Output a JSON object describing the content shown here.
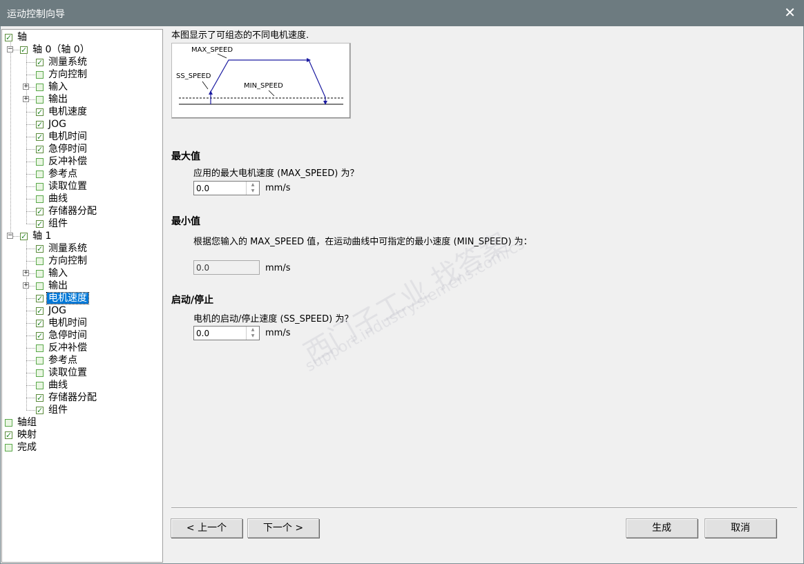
{
  "window": {
    "title": "运动控制向导",
    "close_glyph": "✕"
  },
  "tree": {
    "items": [
      {
        "label": "轴",
        "checked": true
      },
      {
        "label": "轴 0（轴 0）",
        "checked": true
      },
      {
        "label": "测量系统",
        "checked": true
      },
      {
        "label": "方向控制",
        "checked": false
      },
      {
        "label": "输入",
        "checked": false
      },
      {
        "label": "输出",
        "checked": false
      },
      {
        "label": "电机速度",
        "checked": true
      },
      {
        "label": "JOG",
        "checked": true
      },
      {
        "label": "电机时间",
        "checked": true
      },
      {
        "label": "急停时间",
        "checked": true
      },
      {
        "label": "反冲补偿",
        "checked": false
      },
      {
        "label": "参考点",
        "checked": false
      },
      {
        "label": "读取位置",
        "checked": false
      },
      {
        "label": "曲线",
        "checked": false
      },
      {
        "label": "存储器分配",
        "checked": true
      },
      {
        "label": "组件",
        "checked": true
      },
      {
        "label": "轴 1",
        "checked": true
      },
      {
        "label": "测量系统",
        "checked": true
      },
      {
        "label": "方向控制",
        "checked": false
      },
      {
        "label": "输入",
        "checked": false
      },
      {
        "label": "输出",
        "checked": false
      },
      {
        "label": "电机速度",
        "checked": true,
        "selected": true
      },
      {
        "label": "JOG",
        "checked": true
      },
      {
        "label": "电机时间",
        "checked": true
      },
      {
        "label": "急停时间",
        "checked": true
      },
      {
        "label": "反冲补偿",
        "checked": false
      },
      {
        "label": "参考点",
        "checked": false
      },
      {
        "label": "读取位置",
        "checked": false
      },
      {
        "label": "曲线",
        "checked": false
      },
      {
        "label": "存储器分配",
        "checked": true
      },
      {
        "label": "组件",
        "checked": true
      },
      {
        "label": "轴组",
        "checked": false
      },
      {
        "label": "映射",
        "checked": true
      },
      {
        "label": "完成",
        "checked": false
      }
    ]
  },
  "content": {
    "intro": "本图显示了可组态的不同电机速度.",
    "diagram": {
      "max_label": "MAX_SPEED",
      "ss_label": "SS_SPEED",
      "min_label": "MIN_SPEED"
    },
    "max": {
      "title": "最大值",
      "question": "应用的最大电机速度 (MAX_SPEED) 为？",
      "value": "0.0",
      "unit": "mm/s"
    },
    "min": {
      "title": "最小值",
      "question": "根据您输入的 MAX_SPEED 值，在运动曲线中可指定的最小速度 (MIN_SPEED) 为：",
      "value": "0.0",
      "unit": "mm/s"
    },
    "startstop": {
      "title": "启动/停止",
      "question": "电机的启动/停止速度 (SS_SPEED) 为？",
      "value": "0.0",
      "unit": "mm/s"
    }
  },
  "buttons": {
    "prev": "< 上一个",
    "next": "下一个 >",
    "generate": "生成",
    "cancel": "取消"
  },
  "watermark": {
    "line1": "西门子工业   找答案",
    "line2": "support.industry.siemens.com/cs"
  },
  "colors": {
    "titlebar": "#6d7b80",
    "selection": "#0078d7",
    "diagram_line": "#1a1aa0"
  }
}
